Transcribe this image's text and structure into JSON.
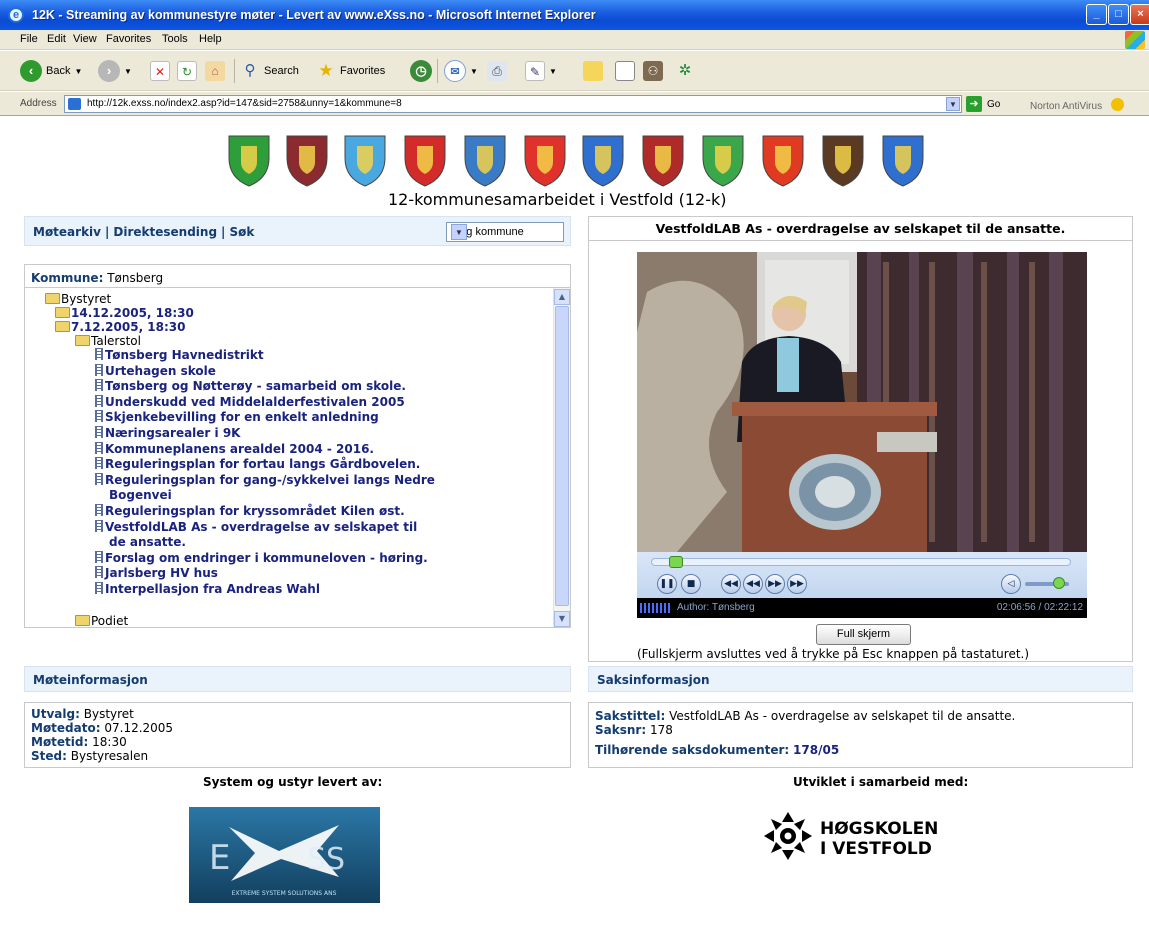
{
  "window": {
    "title": "12K - Streaming av kommunestyre møter - Levert av www.eXss.no - Microsoft Internet Explorer",
    "icon": "ie-logo-icon",
    "buttons": [
      "minimize-icon",
      "maximize-icon",
      "close-icon"
    ]
  },
  "menu": [
    "File",
    "Edit",
    "View",
    "Favorites",
    "Tools",
    "Help"
  ],
  "toolbar": {
    "back_label": "Back",
    "search_label": "Search",
    "favorites_label": "Favorites"
  },
  "address": {
    "label": "Address",
    "url": "http://12k.exss.no/index2.asp?id=147&sid=2758&unny=1&kommune=8",
    "go_label": "Go",
    "norton_label": "Norton AntiVirus"
  },
  "page": {
    "title": "12-kommunesamarbeidet i Vestfold (12-k)",
    "crest_colors": [
      "#2e9e3b",
      "#8b2a2f",
      "#4aa8e0",
      "#d32a2a",
      "#3a7bc6",
      "#e0322a",
      "#2f6fcf",
      "#b02a2a",
      "#3aa84a",
      "#e03a22",
      "#5a3a22",
      "#2f6fcf"
    ]
  },
  "nav": {
    "links": [
      "Møtearkiv",
      "Direktesending",
      "Søk"
    ],
    "select_value": "Velg kommune"
  },
  "tree": {
    "kommune_label": "Kommune:",
    "kommune_value": "Tønsberg",
    "root": "Bystyret",
    "meetings": [
      "14.12.2005, 18:30",
      "7.12.2005, 18:30"
    ],
    "group": "Talerstol",
    "items": [
      "Tønsberg Havnedistrikt",
      "Urtehagen skole",
      "Tønsberg og Nøtterøy - samarbeid om skole.",
      "Underskudd ved Middelalderfestivalen 2005",
      "Skjenkebevilling for en enkelt anledning",
      "Næringsarealer i 9K",
      "Kommuneplanens arealdel 2004 - 2016.",
      "Reguleringsplan for fortau langs Gårdbovelen.",
      "Reguleringsplan for gang-/sykkelvei langs Nedre",
      "Bogenvei",
      "Reguleringsplan for kryssområdet Kilen øst.",
      "VestfoldLAB As - overdragelse av selskapet til",
      "de ansatte.",
      "Forslag om endringer i kommuneloven - høring.",
      "Jarlsberg HV hus",
      "Interpellasjon fra Andreas Wahl"
    ],
    "last_folder": "Podiet"
  },
  "video": {
    "title": "VestfoldLAB As - overdragelse av selskapet til de ansatte.",
    "author": "Author: Tønsberg",
    "time": "02:06:56 / 02:22:12",
    "fullscreen_label": "Full skjerm",
    "fullscreen_note": "(Fullskjerm avsluttes ved å trykke på Esc knappen på tastaturet.)",
    "progress_fraction": 0.04
  },
  "meeting": {
    "header": "Møteinformasjon",
    "rows": [
      {
        "label": "Utvalg:",
        "value": "Bystyret"
      },
      {
        "label": "Møtedato:",
        "value": "07.12.2005"
      },
      {
        "label": "Møtetid:",
        "value": "18:30"
      },
      {
        "label": "Sted:",
        "value": "Bystyresalen"
      }
    ]
  },
  "case": {
    "header": "Saksinformasjon",
    "title_label": "Sakstittel:",
    "title_value": "VestfoldLAB As - overdragelse av selskapet til de ansatte.",
    "nr_label": "Saksnr:",
    "nr_value": "178",
    "docs_label": "Tilhørende saksdokumenter:",
    "docs_value": "178/05"
  },
  "credits": {
    "left": "System og ustyr levert av:",
    "right": "Utviklet i samarbeid med:",
    "exss_tagline": "EXTREME SYSTEM SOLUTIONS ANS",
    "hive_text_1": "HØGSKOLEN",
    "hive_text_2": "I VESTFOLD"
  }
}
